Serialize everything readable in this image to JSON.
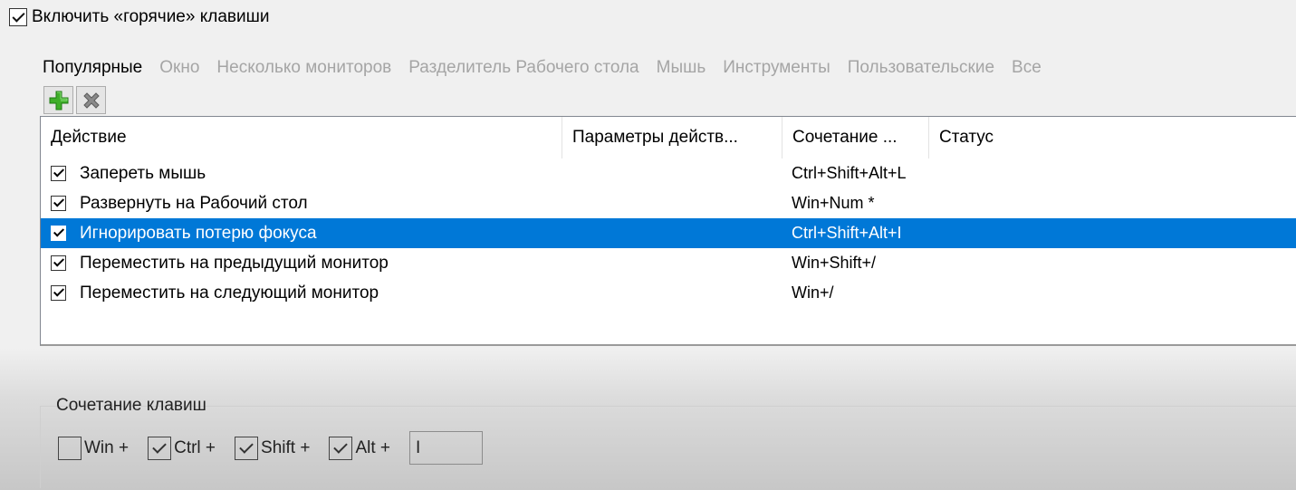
{
  "enable_hotkeys": {
    "label": "Включить «горячие» клавиши",
    "checked": true
  },
  "tabs": [
    "Популярные",
    "Окно",
    "Несколько мониторов",
    "Разделитель Рабочего стола",
    "Мышь",
    "Инструменты",
    "Пользовательские",
    "Все"
  ],
  "active_tab": "Популярные",
  "toolbar": {
    "add_icon": "green-plus-icon",
    "remove_icon": "gray-x-icon"
  },
  "columns": [
    "Действие",
    "Параметры действ...",
    "Сочетание ...",
    "Статус"
  ],
  "rows": [
    {
      "checked": true,
      "action": "Запереть мышь",
      "params": "",
      "keys": "Ctrl+Shift+Alt+L",
      "status": ""
    },
    {
      "checked": true,
      "action": "Развернуть на Рабочий стол",
      "params": "",
      "keys": "Win+Num *",
      "status": ""
    },
    {
      "checked": true,
      "action": "Игнорировать потерю фокуса",
      "params": "",
      "keys": "Ctrl+Shift+Alt+I",
      "status": "",
      "selected": true
    },
    {
      "checked": true,
      "action": "Переместить на предыдущий монитор",
      "params": "",
      "keys": "Win+Shift+/",
      "status": ""
    },
    {
      "checked": true,
      "action": "Переместить на следующий монитор",
      "params": "",
      "keys": "Win+/",
      "status": ""
    }
  ],
  "selection_color": "#0078d7",
  "shortcut_group": {
    "title": "Сочетание клавиш",
    "modifiers": [
      {
        "label": "Win +",
        "checked": false
      },
      {
        "label": "Ctrl +",
        "checked": true
      },
      {
        "label": "Shift +",
        "checked": true
      },
      {
        "label": "Alt +",
        "checked": true
      }
    ],
    "key_value": "I"
  }
}
